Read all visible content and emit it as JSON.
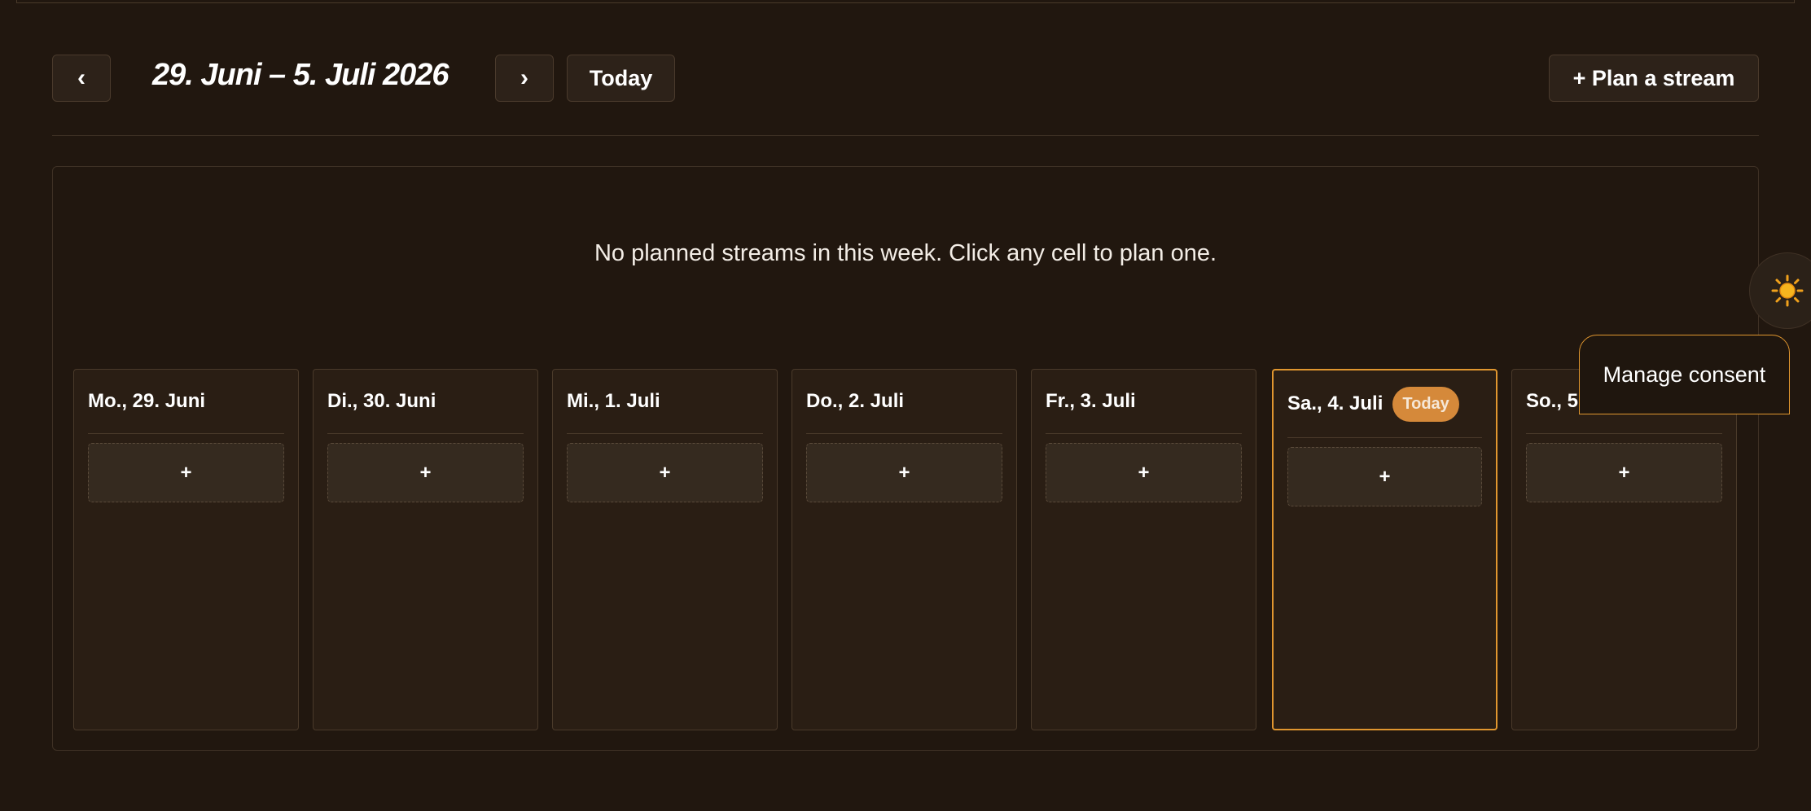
{
  "toolbar": {
    "prev_label": "‹",
    "next_label": "›",
    "week_title": "29. Juni – 5. Juli 2026",
    "today_label": "Today",
    "plan_label": "+ Plan a stream"
  },
  "empty_message": "No planned streams in this week. Click any cell to plan one.",
  "days": [
    {
      "label": "Mo., 29. Juni",
      "add": "+"
    },
    {
      "label": "Di., 30. Juni",
      "add": "+"
    },
    {
      "label": "Mi., 1. Juli",
      "add": "+"
    },
    {
      "label": "Do., 2. Juli",
      "add": "+"
    },
    {
      "label": "Fr., 3. Juli",
      "add": "+"
    },
    {
      "label": "Sa., 4. Juli",
      "add": "+",
      "badge": "Today"
    },
    {
      "label": "So., 5. Juli",
      "add": "+"
    }
  ],
  "consent_label": "Manage consent",
  "theme_icon": "sun-icon",
  "colors": {
    "background": "#21170f",
    "accent": "#e0962f",
    "badge": "#d5893a"
  }
}
